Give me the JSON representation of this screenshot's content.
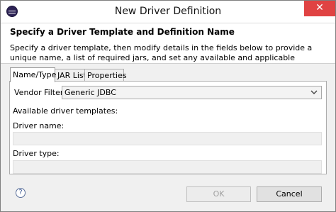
{
  "window": {
    "title": "New Driver Definition",
    "close_glyph": "✕"
  },
  "header": {
    "title": "Specify a Driver Template and Definition Name",
    "description": "Specify a driver template, then modify details in the fields below to provide a unique name, a list of required jars, and set any available and applicable property"
  },
  "tabs": [
    {
      "label": "Name/Type",
      "active": true
    },
    {
      "label": "JAR List",
      "active": false
    },
    {
      "label": "Properties",
      "active": false
    }
  ],
  "form": {
    "vendor_filter_label": "Vendor Filter:",
    "vendor_filter_value": "Generic JDBC",
    "templates_label": "Available driver templates:",
    "driver_name_label": "Driver name:",
    "driver_name_value": "",
    "driver_type_label": "Driver type:",
    "driver_type_value": ""
  },
  "footer": {
    "help_glyph": "?",
    "ok_label": "OK",
    "cancel_label": "Cancel"
  },
  "icons": {
    "app": "eclipse-icon",
    "close": "close-icon",
    "dropdown": "chevron-down-icon",
    "help": "help-icon"
  },
  "colors": {
    "close_button": "#e04343",
    "header_background": "#ffffff",
    "dialog_background": "#f0f0f0"
  }
}
